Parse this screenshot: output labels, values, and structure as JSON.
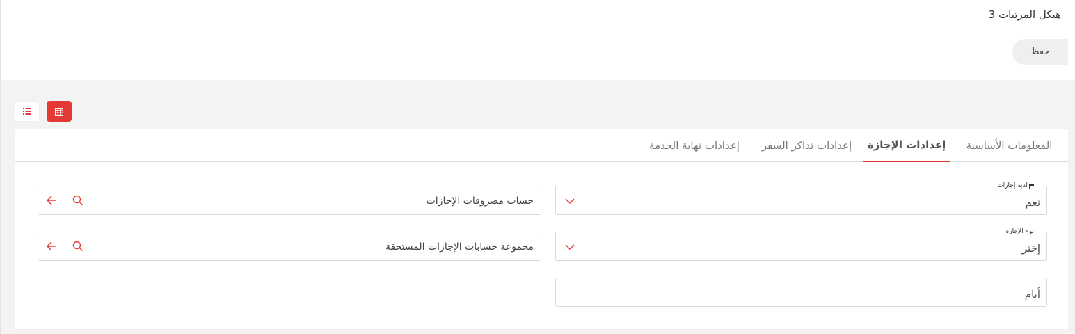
{
  "header": {
    "title": "هيكل المرتبات 3",
    "save_label": "حفظ"
  },
  "view_toggle": {
    "list_icon": "list-icon",
    "grid_icon": "table-grid-icon",
    "active": "grid",
    "accent_color": "#e53935"
  },
  "tabs": [
    {
      "label": "المعلومات الأساسية",
      "active": false
    },
    {
      "label": "إعدادات الإجازة",
      "active": true
    },
    {
      "label": "إعدادات تذاكر السفر",
      "active": false
    },
    {
      "label": "إعدادات نهاية الخدمة",
      "active": false
    }
  ],
  "form": {
    "has_leaves": {
      "label": "لديه إجازات",
      "value": "نعم",
      "icon": "flag-icon"
    },
    "leave_type": {
      "label": "نوع الإجازة",
      "value": "إختر"
    },
    "days": {
      "placeholder": "أيام"
    },
    "leave_expense_account": {
      "value": "حساب مصروفات الإجازات"
    },
    "accrued_leave_accounts_group": {
      "value": "مجموعة حسابات الإجازات المستحقة"
    }
  }
}
